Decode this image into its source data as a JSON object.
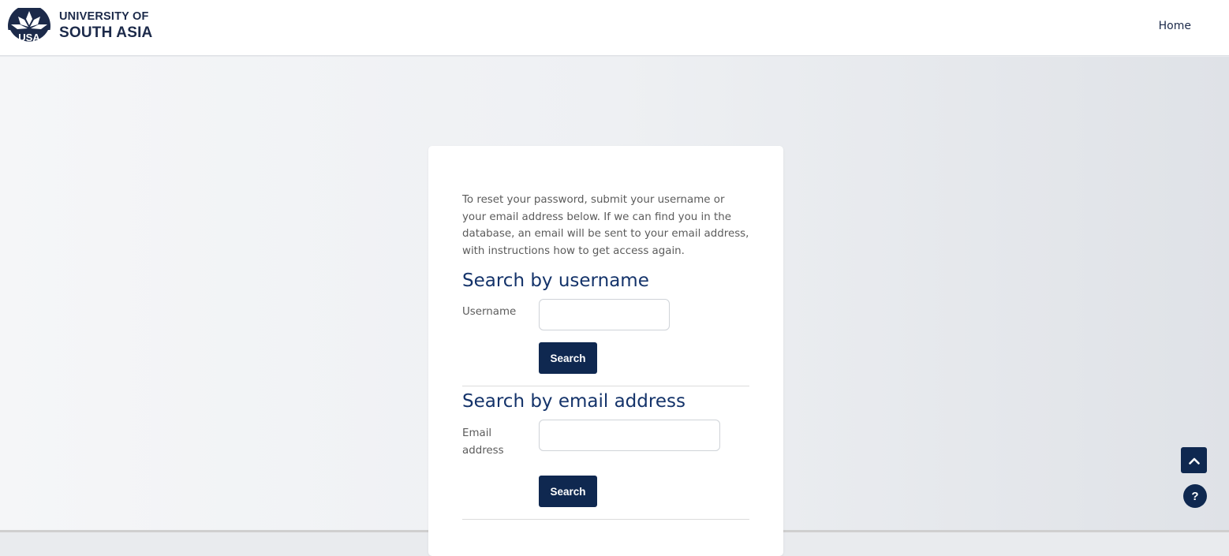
{
  "brand": {
    "logo_text": "USA",
    "name_line1": "UNIVERSITY OF",
    "name_line2": "SOUTH ASIA",
    "logo_icon": "lotus-logo-icon"
  },
  "nav": {
    "home_label": "Home"
  },
  "form": {
    "intro": "To reset your password, submit your username or your email address below. If we can find you in the database, an email will be sent to your email address, with instructions how to get access again.",
    "username_section": {
      "title": "Search by username",
      "field_label": "Username",
      "value": "",
      "button_label": "Search"
    },
    "email_section": {
      "title": "Search by email address",
      "field_label": "Email address",
      "value": "",
      "button_label": "Search"
    }
  },
  "floating": {
    "back_to_top_icon": "chevron-up-icon",
    "help_label": "?"
  },
  "colors": {
    "primary": "#0f2850",
    "heading": "#14336a",
    "brand_text": "#1c2a4a"
  }
}
